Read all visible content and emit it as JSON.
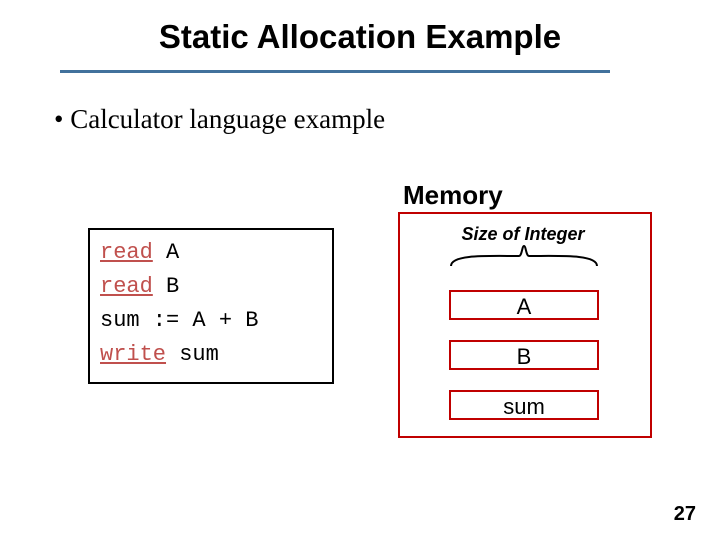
{
  "title": "Static Allocation Example",
  "bullet": "•  Calculator language example",
  "code": {
    "kw_read": "read",
    "kw_write": "write",
    "arg_A": " A",
    "arg_B": " B",
    "line_sum": "sum := A + B",
    "arg_sum": " sum"
  },
  "memory": {
    "header": "Memory",
    "size_label": "Size of Integer",
    "cells": {
      "A": "A",
      "B": "B",
      "sum": "sum"
    }
  },
  "page_number": "27"
}
